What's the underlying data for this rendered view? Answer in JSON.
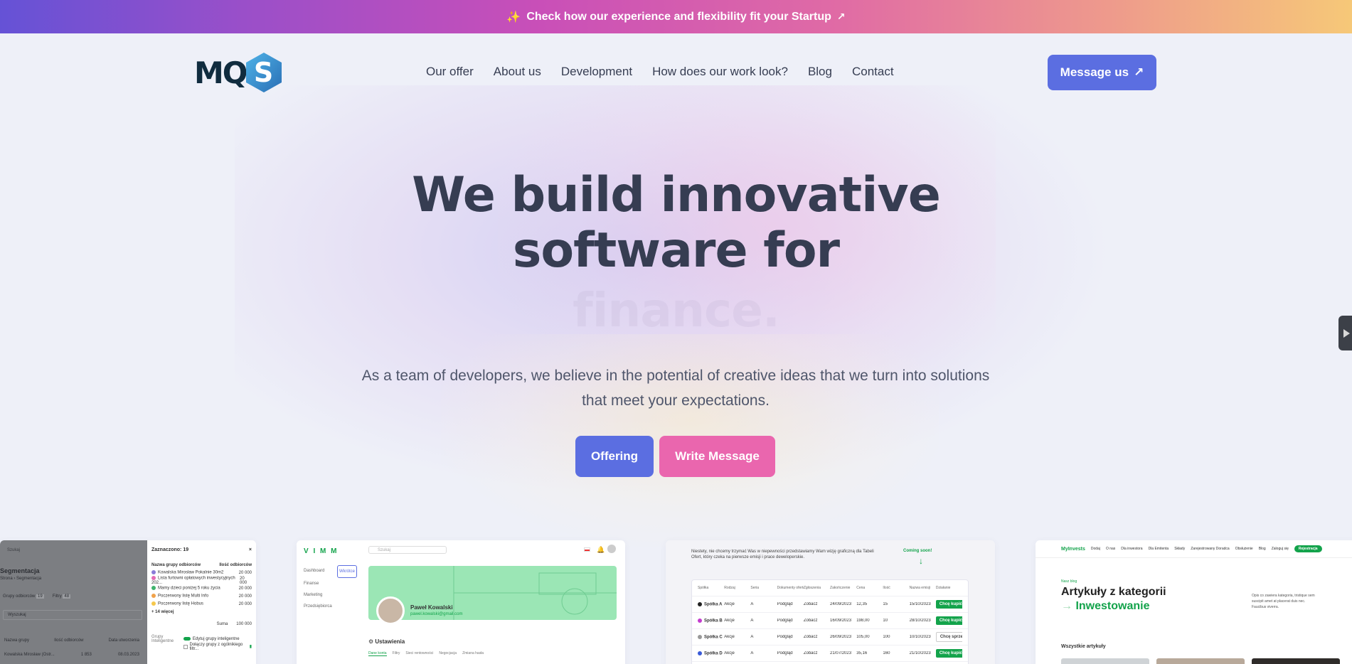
{
  "topbar": {
    "sparkle": "✨",
    "text": "Check how our experience and flexibility fit your Startup",
    "arrow": "↗"
  },
  "brand": {
    "logo_letters": "MQ",
    "logo_hex_letter": "S"
  },
  "nav": {
    "items": [
      "Our offer",
      "About us",
      "Development",
      "How does our work look?",
      "Blog",
      "Contact"
    ],
    "cta_label": "Message us",
    "cta_arrow": "↗"
  },
  "hero": {
    "title_line1": "We build innovative",
    "title_line2": "software for",
    "rotating_word": "finance.",
    "subtitle": "As a team of developers, we believe in the potential of creative ideas that we turn into solutions that meet your expectations.",
    "btn_offering": "Offering",
    "btn_write": "Write Message"
  },
  "showcase": {
    "card1": {
      "search": "Szukaj",
      "heading": "Segmentacja",
      "crumbs": "Strona › Segmentacja",
      "tabs": [
        "Grupy odbiorców",
        "Filtry"
      ],
      "tab_counts": [
        "19",
        "48"
      ],
      "filter_placeholder": "Wyszukaj",
      "list_head": [
        "Nazwa grupy",
        "Ilość odbiorców",
        "Data utworzenia"
      ],
      "list_row": [
        "Kowalska Mirosław (Ostr...",
        "1 853",
        "08.03.2023"
      ],
      "panel_title": "Zaznaczono: 19",
      "panel_close": "×",
      "panel_head": [
        "Nazwa grupy odbiorców",
        "Ilość odbiorców"
      ],
      "panel_rows": [
        {
          "name": "Kowalska Mirosław Pokalnie 30m2",
          "value": "20 000",
          "color": "#8a7bd8"
        },
        {
          "name": "Lista furtowni opłatowych inwestycyjnych 202...",
          "value": "20 000",
          "color": "#e46cb4"
        },
        {
          "name": "Mamy dzieci poniżej 5 roku życia",
          "value": "20 000",
          "color": "#3fb36d"
        },
        {
          "name": "Poczerwony listę Multi Info",
          "value": "20 000",
          "color": "#f0a24b"
        },
        {
          "name": "Poczerwony listę Hobus",
          "value": "20 000",
          "color": "#f5c84c"
        }
      ],
      "more": "+ 14 więcej",
      "sum_label": "Suma",
      "sum_value": "100 000",
      "group_label": "Grupy Inteligentne",
      "group_items": [
        "Edytuj grupy inteligentne",
        "Dołączy grupy z ogólnikiego filtr..."
      ]
    },
    "card2": {
      "logo": "V I M M",
      "search": "Szukaj",
      "nav": [
        "Dashboard",
        "Finanse",
        "Marketing",
        "Przedsiębiorca"
      ],
      "nav_badge": "Wkrótce",
      "user_name": "Paweł Kowalski",
      "user_email": "pawel.kowalski@gmail.com",
      "section": "Ustawienia",
      "tabs": [
        "Dane konta",
        "Filtry",
        "Sieci rentowności",
        "Negocjacja",
        "Zmiana hasła"
      ]
    },
    "card3": {
      "note": "Niestety, nie chcemy trzymać Was w niepewności przedstawiamy Wam wizję graficzną dla Tabeli Ofert, który czeka na pierwsze emisji i prace deweloperskie.",
      "coming_soon": "Coming soon!",
      "headers": [
        "Spółka",
        "Rodzaj",
        "Seria",
        "Dokumenty ofertowe",
        "Zgłoszenia",
        "Zakończenie",
        "Cena",
        "Ilość",
        "Nazwa emisji",
        "Działanie"
      ],
      "rows": [
        {
          "name": "Spółka A",
          "c1": "Akcje",
          "c2": "A",
          "doc": "Podgląd",
          "z": "Zobacz",
          "date": "24/09/2023",
          "price": "12,35",
          "qty": "15",
          "end": "15/10/2023",
          "action": "Chcę kupić",
          "dot": "#222"
        },
        {
          "name": "Spółka B",
          "c1": "Akcje",
          "c2": "A",
          "doc": "Podgląd",
          "z": "Zobacz",
          "date": "16/09/2023",
          "price": "198,00",
          "qty": "10",
          "end": "28/10/2023",
          "action": "Chcę kupić",
          "dot": "#c43ccf"
        },
        {
          "name": "Spółka C",
          "c1": "Akcje",
          "c2": "A",
          "doc": "Podgląd",
          "z": "Zobacz",
          "date": "26/09/2023",
          "price": "105,00",
          "qty": "100",
          "end": "10/10/2023",
          "action": "Chcę sprzedać",
          "dot": "#999"
        },
        {
          "name": "Spółka D",
          "c1": "Akcje",
          "c2": "A",
          "doc": "Podgląd",
          "z": "Zobacz",
          "date": "21/07/2023",
          "price": "35,16",
          "qty": "160",
          "end": "21/10/2023",
          "action": "Chcę kupić",
          "dot": "#3a5bd8"
        }
      ]
    },
    "card4": {
      "logo": "MyInvests",
      "nav": [
        "Dodaj",
        "O nas",
        "Dla inwestora",
        "Dla Emitenta",
        "Składy",
        "Zarejestrowany Doradca",
        "Obsłużenie",
        "Blog"
      ],
      "login": "Zaloguj się",
      "register": "Rejestracja",
      "kicker": "Nasz blog",
      "title": "Artykuły z kategorii",
      "category": "Inwestowanie",
      "desc": "Opis co zawiera kategoria, tristique sem suscipit amet at placerat duis nec. Faucibus viverra.",
      "section": "Wszystkie artykuły"
    }
  },
  "colors": {
    "primary": "#5b6ee1",
    "pink": "#ea66ae",
    "text": "#363d52",
    "green": "#13a34b"
  }
}
